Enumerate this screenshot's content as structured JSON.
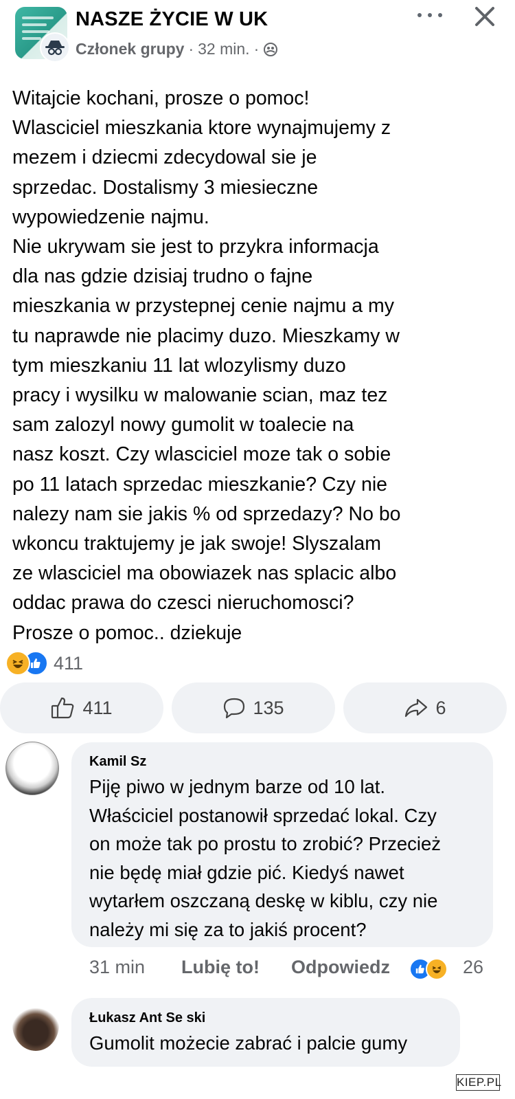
{
  "post": {
    "group_name": "NASZE ŻYCIE W UK",
    "author_label": "Członek grupy",
    "separator": "·",
    "time": "32 min.",
    "separator2": "·",
    "text": "Witajcie kochani, prosze o pomoc!\nWlasciciel mieszkania ktore wynajmujemy z\nmezem i dziecmi zdecydowal sie je\nsprzedac. Dostalismy 3 miesieczne\nwypowiedzenie najmu.\nNie ukrywam sie jest to przykra informacja\ndla nas gdzie dzisiaj trudno o fajne\nmieszkania w przystepnej cenie najmu a my\ntu naprawde nie placimy duzo. Mieszkamy w\ntym mieszkaniu 11 lat wlozylismy duzo\npracy i wysilku w malowanie scian, maz tez\nsam zalozyl nowy gumolit w toalecie na\nnasz koszt. Czy wlasciciel moze tak o sobie\npo 11 latach sprzedac mieszkanie? Czy nie\nnalezy nam sie jakis % od sprzedazy? No bo\nwkoncu traktujemy je jak swoje! Slyszalam\nze wlasciciel ma obowiazek nas splacic albo\noddac prawa do czesci nieruchomosci?\nProsze o pomoc.. dziekuje",
    "reaction_count": "411",
    "like_count": "411",
    "comment_count": "135",
    "share_count": "6"
  },
  "comments": [
    {
      "author": "Kamil Sz",
      "text": "Piję piwo w jednym barze od 10 lat.\nWłaściciel postanowił sprzedać lokal. Czy\non może tak po prostu to zrobić? Przecież\nnie będę miał gdzie pić. Kiedyś nawet\nwytarłem oszczaną deskę w kiblu, czy nie\nnależy mi się za to jakiś procent?",
      "time": "31 min",
      "like_label": "Lubię to!",
      "reply_label": "Odpowiedz",
      "reaction_count": "26"
    },
    {
      "author": "Łukasz Ant Se ski",
      "text": "Gumolit możecie zabrać i palcie gumy"
    }
  ],
  "watermark": "KIEP.PL",
  "colors": {
    "like_blue": "#1877f2",
    "haha_yellow": "#f7b125",
    "bubble": "#f0f2f5",
    "meta_gray": "#65676b"
  }
}
